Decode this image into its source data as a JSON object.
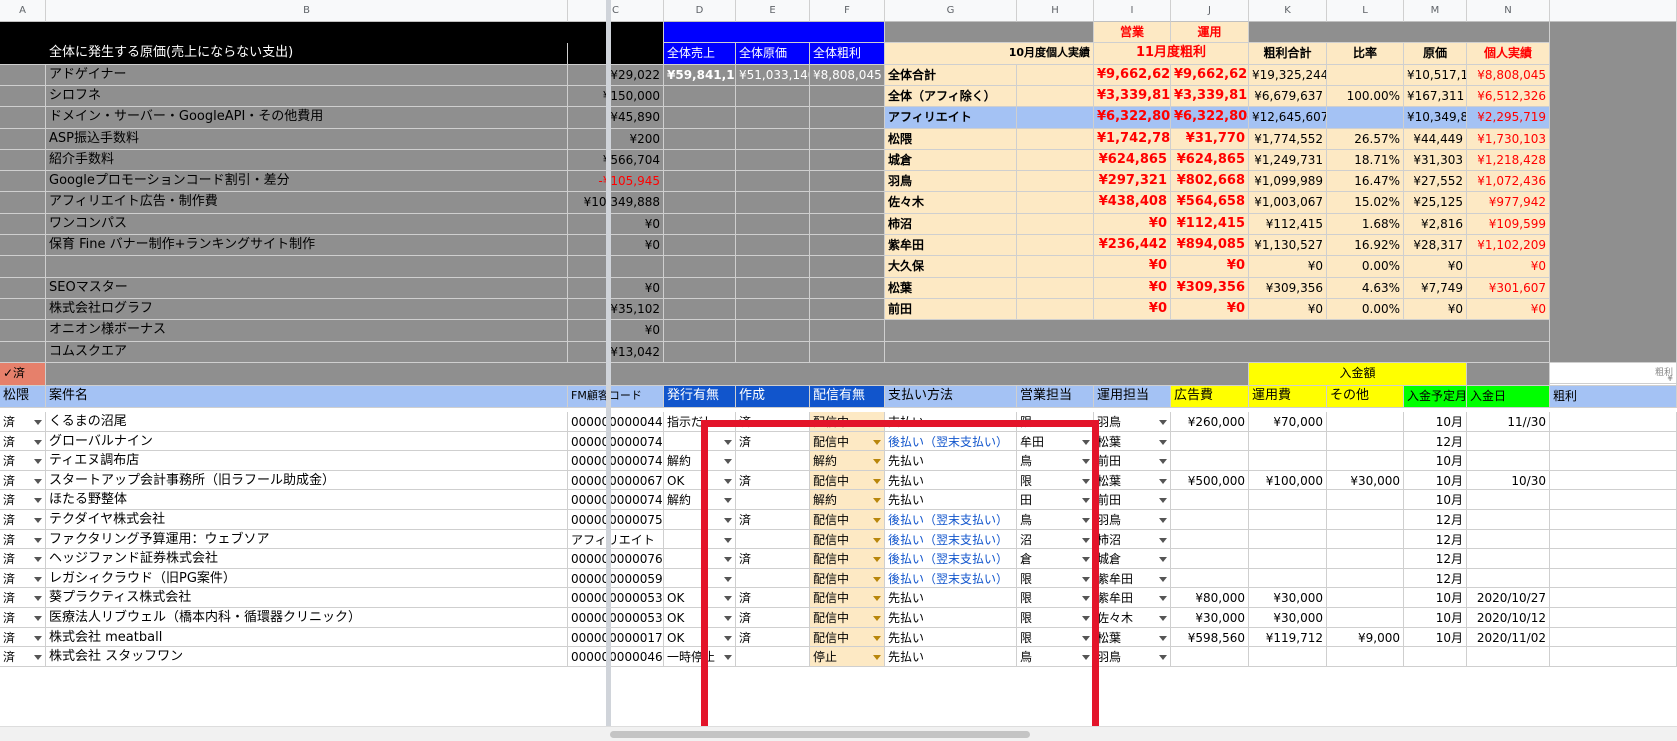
{
  "columns": [
    "A",
    "B",
    "C",
    "D",
    "E",
    "F",
    "G",
    "H",
    "I",
    "J",
    "K",
    "L",
    "M",
    "N"
  ],
  "cost_section": {
    "title": "全体に発生する原価(売上にならない支出)",
    "items": [
      {
        "name": "アドゲイナー",
        "amount": "¥29,022"
      },
      {
        "name": "シロフネ",
        "amount": "¥150,000"
      },
      {
        "name": "ドメイン・サーバー・GoogleAPI・その他費用",
        "amount": "¥45,890"
      },
      {
        "name": "ASP振込手数料",
        "amount": "¥200"
      },
      {
        "name": "紹介手数料",
        "amount": "¥566,704"
      },
      {
        "name": "Googleプロモーションコード割引・差分",
        "amount": "-¥105,945",
        "neg": true
      },
      {
        "name": "アフィリエイト広告・制作費",
        "amount": "¥10,349,888"
      },
      {
        "name": "ワンコンパス",
        "amount": "¥0"
      },
      {
        "name": "保育 Fine バナー制作+ランキングサイト制作",
        "amount": "¥0"
      },
      {
        "name": "",
        "amount": ""
      },
      {
        "name": "SEOマスター",
        "amount": "¥0"
      },
      {
        "name": "株式会社ログラフ",
        "amount": "¥35,102"
      },
      {
        "name": "オニオン様ボーナス",
        "amount": "¥0"
      },
      {
        "name": "コムスクエア",
        "amount": "¥13,042"
      }
    ]
  },
  "totals": {
    "sales_label": "全体売上",
    "cost_label": "全体原価",
    "profit_label": "全体粗利",
    "sales": "¥59,841,185",
    "cost": "¥51,033,140",
    "profit": "¥8,808,045"
  },
  "summary": {
    "eigyo": "営業",
    "unyo": "運用",
    "oct_label": "10月度個人実績",
    "nov_label": "11月度粗利",
    "headers": {
      "k": "粗利合計",
      "l": "比率",
      "m": "原価",
      "n": "個人実績"
    },
    "rows": [
      {
        "name": "全体合計",
        "i": "¥9,662,622",
        "j": "¥9,662,622",
        "k": "¥19,325,244",
        "l": "",
        "m": "¥10,517,19",
        "n": "¥8,808,045"
      },
      {
        "name": "全体（アフィ除く）",
        "i": "¥3,339,818",
        "j": "¥3,339,818",
        "k": "¥6,679,637",
        "l": "100.00%",
        "m": "¥167,311",
        "n": "¥6,512,326"
      },
      {
        "name": "アフィリエイト",
        "i": "¥6,322,804",
        "j": "¥6,322,804",
        "k": "¥12,645,607",
        "l": "",
        "m": "¥10,349,88",
        "n": "¥2,295,719",
        "hl": true
      },
      {
        "name": "松隈",
        "i": "¥1,742,782",
        "j": "¥31,770",
        "k": "¥1,774,552",
        "l": "26.57%",
        "m": "¥44,449",
        "n": "¥1,730,103"
      },
      {
        "name": "城倉",
        "i": "¥624,865",
        "j": "¥624,865",
        "k": "¥1,249,731",
        "l": "18.71%",
        "m": "¥31,303",
        "n": "¥1,218,428"
      },
      {
        "name": "羽鳥",
        "i": "¥297,321",
        "j": "¥802,668",
        "k": "¥1,099,989",
        "l": "16.47%",
        "m": "¥27,552",
        "n": "¥1,072,436"
      },
      {
        "name": "佐々木",
        "i": "¥438,408",
        "j": "¥564,658",
        "k": "¥1,003,067",
        "l": "15.02%",
        "m": "¥25,125",
        "n": "¥977,942"
      },
      {
        "name": "柿沼",
        "i": "¥0",
        "j": "¥112,415",
        "k": "¥112,415",
        "l": "1.68%",
        "m": "¥2,816",
        "n": "¥109,599"
      },
      {
        "name": "紫牟田",
        "i": "¥236,442",
        "j": "¥894,085",
        "k": "¥1,130,527",
        "l": "16.92%",
        "m": "¥28,317",
        "n": "¥1,102,209"
      },
      {
        "name": "大久保",
        "i": "¥0",
        "j": "¥0",
        "k": "¥0",
        "l": "0.00%",
        "m": "¥0",
        "n": "¥0"
      },
      {
        "name": "松葉",
        "i": "¥0",
        "j": "¥309,356",
        "k": "¥309,356",
        "l": "4.63%",
        "m": "¥7,749",
        "n": "¥301,607"
      },
      {
        "name": "前田",
        "i": "¥0",
        "j": "¥0",
        "k": "¥0",
        "l": "0.00%",
        "m": "¥0",
        "n": "¥0"
      }
    ]
  },
  "side_small": {
    "a": "粗利",
    "b": "¥"
  },
  "filter": {
    "check": "✓済",
    "person": "松隈"
  },
  "header_row": {
    "b": "案件名",
    "c": "FM顧客コード",
    "d": "発行有無",
    "e": "作成",
    "f": "配信有無",
    "g": "支払い方法",
    "h": "営業担当",
    "i": "運用担当",
    "money_group": "入金額",
    "j": "広告費",
    "k": "運用費",
    "l": "その他",
    "m": "入金予定月",
    "n": "入金日",
    "o": "粗利"
  },
  "rows": [
    {
      "a": "済",
      "b": "くるまの沼尾",
      "c": "0000000000442",
      "d": "指示だし",
      "e": "済",
      "f": "配信中",
      "g": "支払い",
      "h": "限",
      "i": "羽鳥",
      "j": "¥260,000",
      "k": "¥70,000",
      "l": "",
      "m": "10月",
      "n": "11//30"
    },
    {
      "a": "済",
      "b": "グローバルナイン",
      "c": "0000000000746",
      "d": "",
      "e": "済",
      "f": "配信中",
      "g": "後払い（翌末支払い）",
      "glink": true,
      "h": "牟田",
      "i": "松葉",
      "j": "",
      "k": "",
      "l": "",
      "m": "12月",
      "n": ""
    },
    {
      "a": "済",
      "b": "ティエヌ調布店",
      "c": "0000000000749",
      "d": "解約",
      "e": "",
      "f": "解約",
      "g": "先払い",
      "h": "鳥",
      "i": "前田",
      "j": "",
      "k": "",
      "l": "",
      "m": "10月",
      "n": ""
    },
    {
      "a": "済",
      "b": "スタートアップ会計事務所（旧ラフール助成金）",
      "c": "0000000000679",
      "d": "OK",
      "e": "済",
      "f": "配信中",
      "g": "先払い",
      "h": "限",
      "i": "松葉",
      "j": "¥500,000",
      "k": "¥100,000",
      "l": "¥30,000",
      "m": "10月",
      "n": "10/30"
    },
    {
      "a": "済",
      "b": "ほたる野整体",
      "c": "0000000000749",
      "d": "解約",
      "e": "",
      "f": "解約",
      "g": "先払い",
      "h": "田",
      "i": "前田",
      "j": "",
      "k": "",
      "l": "",
      "m": "10月",
      "n": ""
    },
    {
      "a": "済",
      "b": "テクダイヤ株式会社",
      "c": "0000000000751",
      "d": "",
      "e": "済",
      "f": "配信中",
      "g": "後払い（翌末支払い）",
      "glink": true,
      "h": "鳥",
      "i": "羽鳥",
      "j": "",
      "k": "",
      "l": "",
      "m": "12月",
      "n": ""
    },
    {
      "a": "済",
      "b": "ファクタリング予算運用：ウェブソア",
      "c": "アフィリエイト",
      "d": "",
      "e": "",
      "f": "配信中",
      "g": "後払い（翌末支払い）",
      "glink": true,
      "h": "沼",
      "i": "柿沼",
      "j": "",
      "k": "",
      "l": "",
      "m": "12月",
      "n": ""
    },
    {
      "a": "済",
      "b": "ヘッジファンド証券株式会社",
      "c": "0000000000760",
      "d": "",
      "e": "済",
      "f": "配信中",
      "g": "後払い（翌末支払い）",
      "glink": true,
      "h": "倉",
      "i": "城倉",
      "j": "",
      "k": "",
      "l": "",
      "m": "12月",
      "n": ""
    },
    {
      "a": "済",
      "b": "レガシィクラウド（旧PG案件）",
      "c": "0000000000591",
      "d": "",
      "e": "",
      "f": "配信中",
      "g": "後払い（翌末支払い）",
      "glink": true,
      "h": "限",
      "i": "紫牟田",
      "j": "",
      "k": "",
      "l": "",
      "m": "12月",
      "n": ""
    },
    {
      "a": "済",
      "b": "葵プラクティス株式会社",
      "c": "0000000000539",
      "d": "OK",
      "e": "済",
      "f": "配信中",
      "g": "先払い",
      "h": "限",
      "i": "紫牟田",
      "j": "¥80,000",
      "k": "¥30,000",
      "l": "",
      "m": "10月",
      "n": "2020/10/27"
    },
    {
      "a": "済",
      "b": "医療法人リブウェル（橋本内科・循環器クリニック）",
      "c": "0000000000539",
      "d": "OK",
      "e": "済",
      "f": "配信中",
      "g": "先払い",
      "h": "限",
      "i": "佐々木",
      "j": "¥30,000",
      "k": "¥30,000",
      "l": "",
      "m": "10月",
      "n": "2020/10/12"
    },
    {
      "a": "済",
      "b": "株式会社 meatball",
      "c": "0000000000179",
      "d": "OK",
      "e": "済",
      "f": "配信中",
      "g": "先払い",
      "h": "限",
      "i": "松葉",
      "j": "¥598,560",
      "k": "¥119,712",
      "l": "¥9,000",
      "m": "10月",
      "n": "2020/11/02"
    },
    {
      "a": "済",
      "b": "株式会社 スタッフワン",
      "c": "0000000000468",
      "d": "一時停止",
      "e": "",
      "f": "停止",
      "g": "先払い",
      "h": "鳥",
      "i": "羽鳥",
      "j": "",
      "k": "",
      "l": "",
      "m": "",
      "n": ""
    }
  ]
}
